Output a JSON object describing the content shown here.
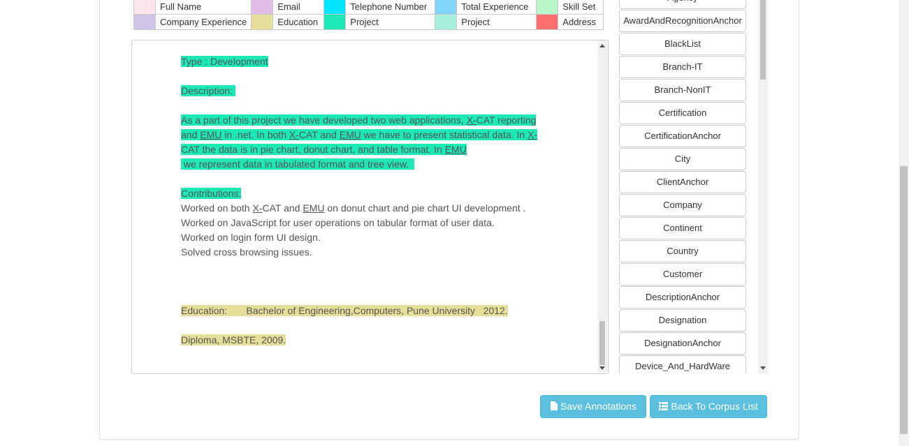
{
  "legend": {
    "rows": [
      [
        {
          "label": "Full Name",
          "color": "#fce4ec"
        },
        {
          "label": "Email",
          "color": "#e1bee7"
        },
        {
          "label": "Telephone Number",
          "color": "#00e5ff"
        },
        {
          "label": "Total Experience",
          "color": "#81d4fa"
        },
        {
          "label": "Skill Set",
          "color": "#b9f6ca"
        }
      ],
      [
        {
          "label": "Company Experience",
          "color": "#d1c4e9"
        },
        {
          "label": "Education",
          "color": "#e6df9a"
        },
        {
          "label": "Project",
          "color": "#1de9b6"
        },
        {
          "label": "Project",
          "color": "#a7f0dd"
        },
        {
          "label": "Address",
          "color": "#ff6f70"
        }
      ]
    ]
  },
  "document": {
    "type_line": "Type : Development",
    "description_label": "Description: ",
    "description_parts": [
      "As a part of this project we have developed two web applications, ",
      "X-",
      "CAT reporting and ",
      "EMU",
      " in .net. In both ",
      "X-",
      "CAT and ",
      "EMU",
      " we have to present statistical data. In ",
      "X-",
      "CAT the data is in pie chart, donut chart, and table format. In ",
      "EMU",
      " we represent data in tabulated format and tree view.  "
    ],
    "contributions_label": "Contributions:",
    "contribution_first_parts": [
      "Worked on both ",
      "X-",
      "CAT and ",
      "EMU",
      " on donut chart and pie chart UI development ."
    ],
    "contributions": [
      "Worked on JavaScript for user operations on tabular format of user data.",
      "Worked on login form UI design.",
      "Solved cross browsing issues."
    ],
    "education_line": "Education:       Bachelor of Engineering,Computers, Pune University   2012.",
    "diploma_line": "Diploma, MSBTE, 2009."
  },
  "entities": [
    "Agency",
    "AwardAndRecognitionAnchor",
    "BlackList",
    "Branch-IT",
    "Branch-NonIT",
    "Certification",
    "CertificationAnchor",
    "City",
    "ClientAnchor",
    "Company",
    "Continent",
    "Country",
    "Customer",
    "DescriptionAnchor",
    "Designation",
    "DesignationAnchor",
    "Device_And_HardWare"
  ],
  "actions": {
    "save_label": "Save Annotations",
    "back_label": "Back To Corpus List",
    "save_icon": "file-icon",
    "back_icon": "list-icon"
  }
}
